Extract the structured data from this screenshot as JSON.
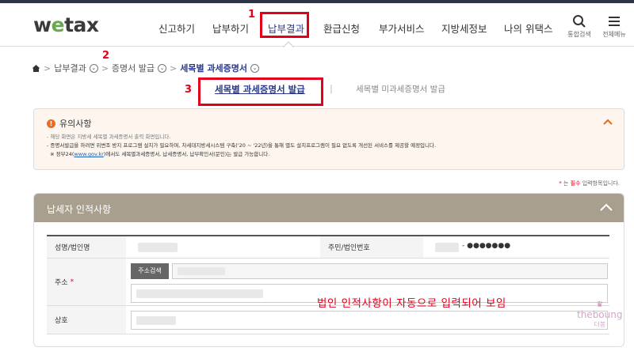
{
  "header": {
    "logo_pre": "w",
    "logo_e": "e",
    "logo_post": "tax",
    "nav": [
      "신고하기",
      "납부하기",
      "납부결과",
      "환급신청",
      "부가서비스",
      "지방세정보",
      "나의 위택스"
    ],
    "search_label": "통합검색",
    "menu_label": "전체메뉴"
  },
  "steps": {
    "one": "1",
    "two": "2",
    "three": "3"
  },
  "breadcrumb": {
    "items": [
      "납부결과",
      "증명서 발급",
      "세목별 과세증명서"
    ]
  },
  "subtabs": {
    "active": "세목별 과세증명서 발급",
    "divider": "|",
    "inactive": "세목별 미과세증명서 발급"
  },
  "notice": {
    "title": "유의사항",
    "line1": "- 해당 화면은 지방세 세목별 과세증명서 출력 화면입니다.",
    "line2": "- 증명서발급을 하려면 위변조 방지 프로그램 설치가 필요하며, 차세대지방세시스템 구축('20 ~ '22년)을 통해 별도 설치프로그램이 필요 없도록 개선된 서비스를 제공할 예정입니다.",
    "line3_pre": "※ 정부24(",
    "line3_link": "www.gov.kr",
    "line3_post": ")에서도 세목별과세증명서, 납세증명서, 납부확인서(문인)는 발급 가능합니다."
  },
  "required_note": {
    "star": "*",
    "pre": " 는 ",
    "red": "필수",
    "post": " 입력항목입니다."
  },
  "panel": {
    "title": "납세자 인적사항",
    "name_label": "성명/법인명",
    "id_label": "주민/법인번호",
    "id_value": "- ●●●●●●●",
    "addr_label": "주소",
    "addr_required": "*",
    "addr_button": "주소검색",
    "company_label": "상호"
  },
  "annotation": "법인 인적사항이 자동으로 입력되어 보임",
  "watermark": {
    "crown": "♛",
    "name": "theboung",
    "sub": "더봉"
  }
}
